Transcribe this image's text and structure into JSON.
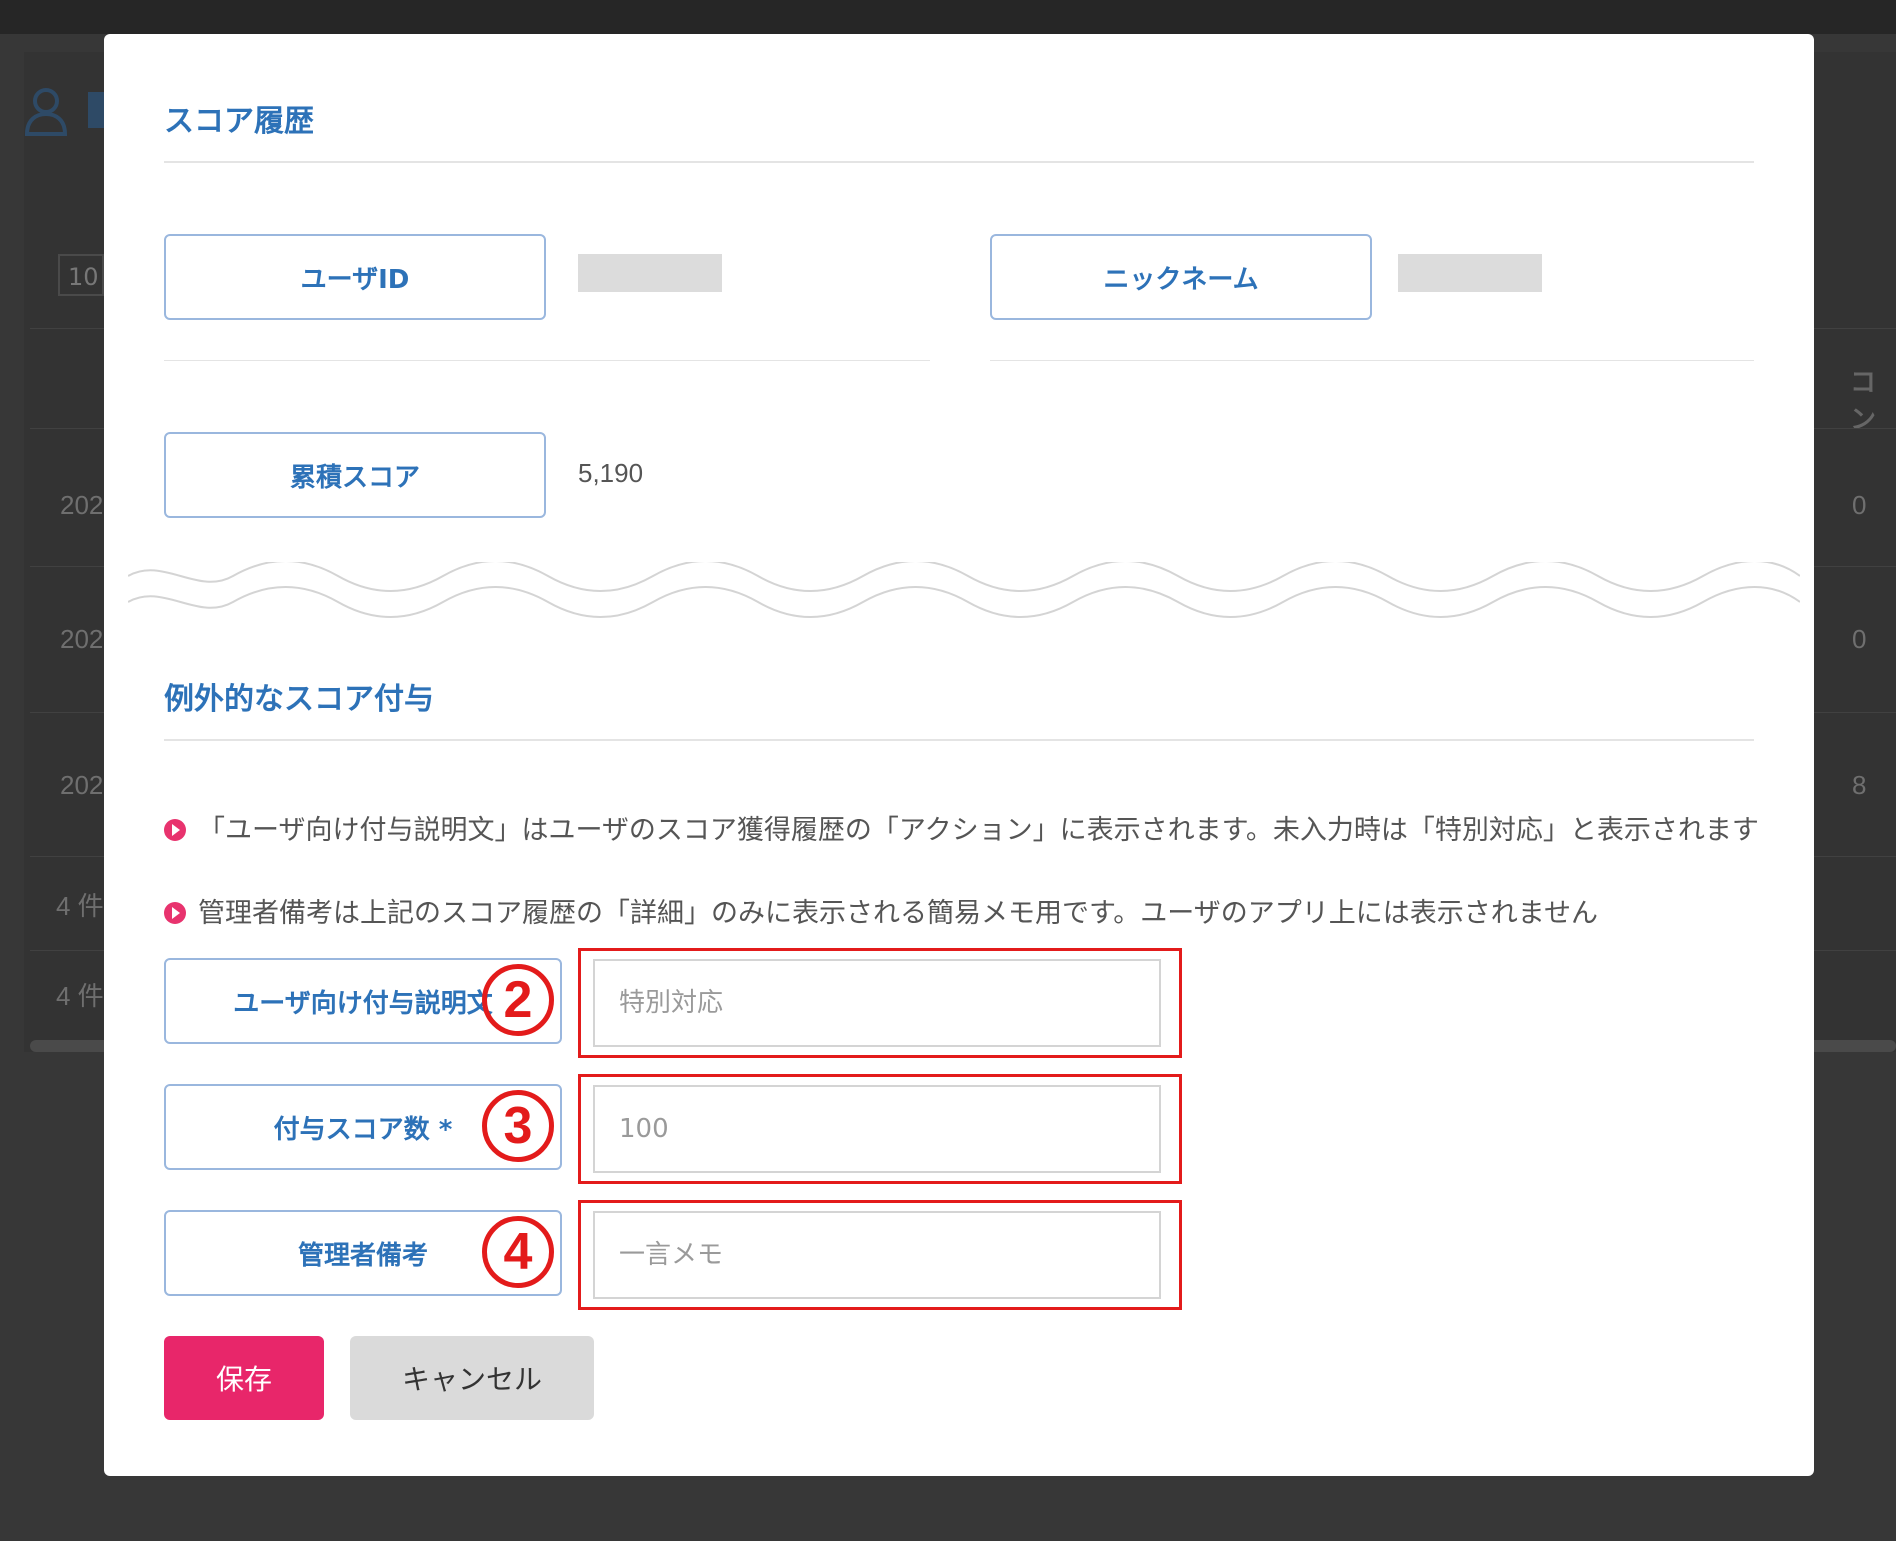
{
  "background": {
    "select_value": "10",
    "header_stub": "コン",
    "rows": [
      {
        "left": "202",
        "right": "0"
      },
      {
        "left": "202",
        "right": "0"
      },
      {
        "left": "202",
        "right": "8"
      }
    ],
    "count_texts": [
      "4 件",
      "4 件"
    ]
  },
  "modal": {
    "history_title": "スコア履歴",
    "user_id_label": "ユーザID",
    "nickname_label": "ニックネーム",
    "total_score_label": "累積スコア",
    "total_score_value": "5,190",
    "grant_title": "例外的なスコア付与",
    "notes": [
      "「ユーザ向け付与説明文」はユーザのスコア獲得履歴の「アクション」に表示されます。未入力時は「特別対応」と表示されます",
      "管理者備考は上記のスコア履歴の「詳細」のみに表示される簡易メモ用です。ユーザのアプリ上には表示されません"
    ],
    "fields": {
      "description": {
        "label": "ユーザ向け付与説明文",
        "placeholder": "特別対応",
        "badge": "2"
      },
      "score": {
        "label": "付与スコア数 *",
        "placeholder": "100",
        "badge": "3"
      },
      "memo": {
        "label": "管理者備考",
        "placeholder": "一言メモ",
        "badge": "4"
      }
    },
    "buttons": {
      "save": "保存",
      "cancel": "キャンセル"
    }
  },
  "colors": {
    "accent_blue": "#2d72b8",
    "save_pink": "#e8266a",
    "annotation_red": "#e31b1b"
  }
}
